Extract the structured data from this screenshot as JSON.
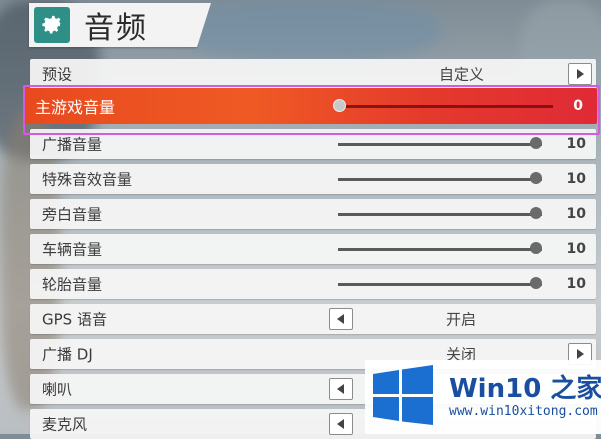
{
  "header": {
    "title": "音频",
    "icon": "gear-icon",
    "accent": "#2e8f86"
  },
  "rows": {
    "preset": {
      "label": "预设",
      "value": "自定义"
    },
    "main_volume": {
      "label": "主游戏音量",
      "value": "0",
      "level": 0
    },
    "broadcast_volume": {
      "label": "广播音量",
      "value": "10",
      "level": 1
    },
    "special_fx_volume": {
      "label": "特殊音效音量",
      "value": "10",
      "level": 1
    },
    "narration_volume": {
      "label": "旁白音量",
      "value": "10",
      "level": 1
    },
    "vehicle_volume": {
      "label": "车辆音量",
      "value": "10",
      "level": 1
    },
    "tire_volume": {
      "label": "轮胎音量",
      "value": "10",
      "level": 1
    },
    "gps_voice": {
      "label": "GPS 语音",
      "value": "开启"
    },
    "broadcast_dj": {
      "label": "广播 DJ",
      "value": "关闭"
    },
    "speaker": {
      "label": "喇叭",
      "value": ""
    },
    "microphone": {
      "label": "麦克风",
      "value": ""
    }
  },
  "watermark": {
    "title": "Win10 之家",
    "url": "www.win10xitong.com"
  },
  "colors": {
    "selected_start": "#e84a1e",
    "selected_end": "#e02a36",
    "focus": "#d35be0"
  }
}
